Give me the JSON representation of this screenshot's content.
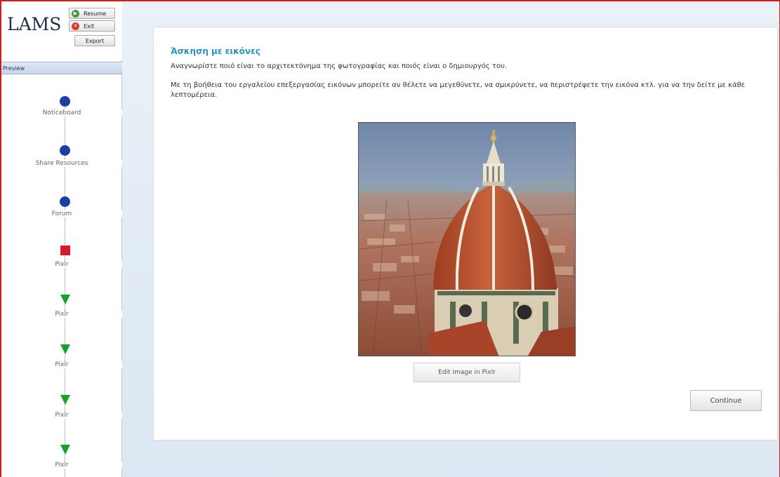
{
  "header": {
    "logo": "LAMS",
    "resume_label": "Resume",
    "exit_label": "Exit",
    "export_label": "Export"
  },
  "sidebar": {
    "preview_label": "Preview",
    "activities": [
      {
        "label": "Noticeboard",
        "icon": "blue-circle-icon"
      },
      {
        "label": "Share Resources",
        "icon": "blue-circle-icon"
      },
      {
        "label": "Forum",
        "icon": "blue-circle-icon"
      },
      {
        "label": "Pixlr",
        "icon": "red-square-icon"
      },
      {
        "label": "Pixlr",
        "icon": "green-triangle-icon"
      },
      {
        "label": "Pixlr",
        "icon": "green-triangle-icon"
      },
      {
        "label": "Pixlr",
        "icon": "green-triangle-icon"
      },
      {
        "label": "Pixlr",
        "icon": "green-triangle-icon"
      }
    ]
  },
  "main": {
    "title": "Άσκηση με εικόνες",
    "instructions_1": "Αναγνωρίστε ποιό είναι το αρχιτεκτόνημα της φωτογραφίας και ποιός είναι ο δημιουργός του.",
    "instructions_2": "Με τη βοήθεια του εργαλείου επεξεργασίας εικόνων μπορείτε αν θέλετε να μεγεθύνετε, να σμικρύνετε, να περιστρέψετε την εικόνα κτλ. για να την δείτε με κάθε λεπτομέρεια.",
    "edit_button_label": "Edit Image in Pixlr",
    "continue_label": "Continue"
  },
  "colors": {
    "title": "#2c90c4",
    "frame_border": "#cc1f1f",
    "activity_blue": "#1c3fa3",
    "activity_red": "#d31a2a",
    "activity_green": "#16a02c"
  }
}
